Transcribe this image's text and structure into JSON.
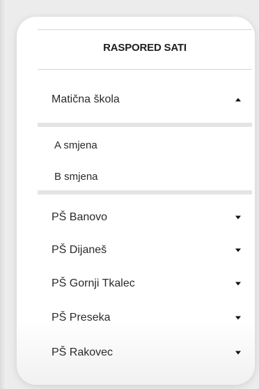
{
  "menu": {
    "title": "RASPORED SATI",
    "main_school": {
      "label": "Matična škola",
      "caret_icon": "caret-up-icon",
      "subitems": [
        "A smjena",
        "B smjena"
      ]
    },
    "branches": [
      {
        "label": "PŠ Banovo",
        "caret_icon": "caret-down-icon"
      },
      {
        "label": "PŠ Dijaneš",
        "caret_icon": "caret-down-icon"
      },
      {
        "label": "PŠ Gornji Tkalec",
        "caret_icon": "caret-down-icon"
      },
      {
        "label": "PŠ Preseka",
        "caret_icon": "caret-down-icon"
      },
      {
        "label": "PŠ Rakovec",
        "caret_icon": "caret-down-icon"
      }
    ]
  },
  "colors": {
    "background": "#ececec",
    "card": "#ffffff",
    "text": "#2a2a2a",
    "divider": "#d5d5d5"
  }
}
